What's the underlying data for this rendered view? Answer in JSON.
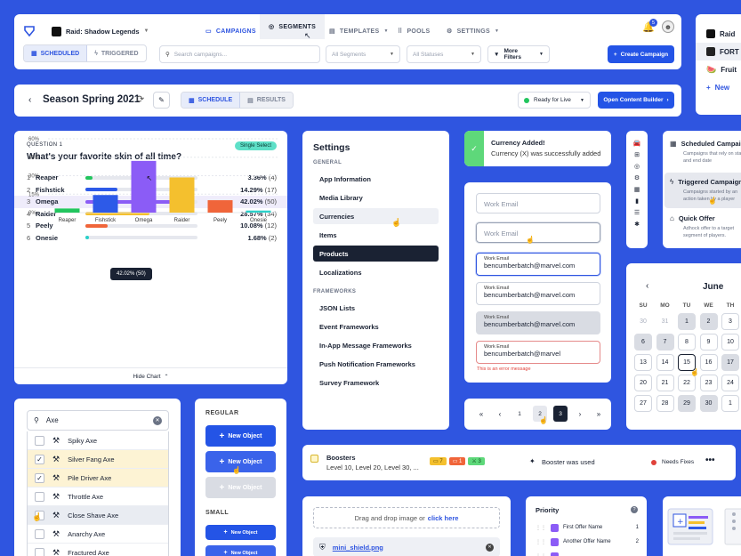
{
  "topnav": {
    "game": "Raid: Shadow Legends",
    "tabs": [
      {
        "label": "CAMPAIGNS",
        "icon": "megaphone-icon"
      },
      {
        "label": "SEGMENTS",
        "icon": "target-icon"
      },
      {
        "label": "TEMPLATES",
        "icon": "template-icon"
      },
      {
        "label": "POOLS",
        "icon": "grid-icon"
      },
      {
        "label": "SETTINGS",
        "icon": "gear-icon"
      }
    ],
    "notif_count": "5",
    "mode_scheduled": "SCHEDULED",
    "mode_triggered": "TRIGGERED",
    "search_placeholder": "Search campaigns...",
    "segments_select": "All Segments",
    "statuses_select": "All Statuses",
    "more_filters": "More Filters",
    "create_campaign": "Create Campaign"
  },
  "gamelist": {
    "items": [
      "Raid",
      "FORT",
      "Fruit"
    ],
    "new_label": "New"
  },
  "seasonbar": {
    "title": "Season Spring 2021",
    "tab_schedule": "SCHEDULE",
    "tab_results": "RESULTS",
    "status": "Ready for Live",
    "status_color": "#22c55e",
    "open_builder": "Open Content Builder"
  },
  "question": {
    "label": "QUESTION 1",
    "badge": "Single Select",
    "title": "What's your favorite skin of all time?",
    "options": [
      {
        "n": "1",
        "name": "Reaper",
        "pct": "3.36%",
        "count": "(4)",
        "value": 3.36,
        "color": "#22c55e"
      },
      {
        "n": "2",
        "name": "Fishstick",
        "pct": "14.29%",
        "count": "(17)",
        "value": 14.29,
        "color": "#2d5ae8"
      },
      {
        "n": "3",
        "name": "Omega",
        "pct": "42.02%",
        "count": "(50)",
        "value": 42.02,
        "color": "#8b5cf6"
      },
      {
        "n": "4",
        "name": "Raider",
        "pct": "28.57%",
        "count": "(34)",
        "value": 28.57,
        "color": "#f4c02e"
      },
      {
        "n": "5",
        "name": "Peely",
        "pct": "10.08%",
        "count": "(12)",
        "value": 10.08,
        "color": "#f0653a"
      },
      {
        "n": "6",
        "name": "Onesie",
        "pct": "1.68%",
        "count": "(2)",
        "value": 1.68,
        "color": "#2ad1c9"
      }
    ],
    "tooltip": "42.02% (50)",
    "hide_chart": "Hide Chart"
  },
  "chart_data": {
    "type": "bar",
    "categories": [
      "Reaper",
      "Fishstick",
      "Omega",
      "Raider",
      "Peely",
      "Onesie"
    ],
    "values": [
      3.36,
      14.29,
      42.02,
      28.57,
      10.08,
      1.68
    ],
    "yticks": [
      "60%",
      "45%",
      "30%",
      "15%",
      "0%"
    ],
    "ylim": [
      0,
      60
    ],
    "colors": [
      "#22c55e",
      "#2d5ae8",
      "#8b5cf6",
      "#f4c02e",
      "#f0653a",
      "#2ad1c9"
    ]
  },
  "settings": {
    "title": "Settings",
    "general": "GENERAL",
    "general_items": [
      "App Information",
      "Media Library",
      "Currencies",
      "Items",
      "Products",
      "Localizations"
    ],
    "frameworks": "FRAMEWORKS",
    "framework_items": [
      "JSON Lists",
      "Event Frameworks",
      "In-App Message Frameworks",
      "Push Notification Frameworks",
      "Survey Framework"
    ]
  },
  "toast": {
    "title": "Currency Added!",
    "message": "Currency (X) was successfully added"
  },
  "inputs": {
    "placeholder": "Work Email",
    "label": "Work Email",
    "value": "bencumberbatch@marvel.com",
    "value_error": "bencumberbatch@marvel",
    "error": "This is an error message"
  },
  "pager": {
    "first": "«",
    "prev": "‹",
    "pages": [
      "1",
      "2",
      "3"
    ],
    "next": "›",
    "last": "»"
  },
  "ctype": {
    "items": [
      {
        "title": "Scheduled Campaign",
        "desc": "Campaigns that rely on start and end date"
      },
      {
        "title": "Triggered Campaign",
        "desc": "Campaigns started by an action taken by a player"
      },
      {
        "title": "Quick Offer",
        "desc": "Adhock offer to a target segment of players."
      }
    ]
  },
  "calendar": {
    "month": "June",
    "days": [
      "SU",
      "MO",
      "TU",
      "WE",
      "TH"
    ],
    "rows": [
      [
        "30",
        "31",
        "1",
        "2",
        "3"
      ],
      [
        "6",
        "7",
        "8",
        "9",
        "10"
      ],
      [
        "13",
        "14",
        "15",
        "16",
        "17"
      ],
      [
        "20",
        "21",
        "22",
        "23",
        "24"
      ],
      [
        "27",
        "28",
        "29",
        "30",
        "1"
      ]
    ]
  },
  "searchlist": {
    "query": "Axe",
    "items": [
      {
        "name": "Spiky Axe",
        "checked": false
      },
      {
        "name": "Silver Fang Axe",
        "checked": true
      },
      {
        "name": "Pile Driver Axe",
        "checked": true
      },
      {
        "name": "Throttle Axe",
        "checked": false
      },
      {
        "name": "Close Shave Axe",
        "checked": false
      },
      {
        "name": "Anarchy Axe",
        "checked": false
      },
      {
        "name": "Fractured Axe",
        "checked": false
      }
    ]
  },
  "buttons": {
    "regular": "REGULAR",
    "small": "SMALL",
    "label": "New Object"
  },
  "boosters": {
    "title": "Boosters",
    "sub": "Level 10, Level 20, Level 30, ...",
    "tags": [
      "7",
      "1",
      "3"
    ],
    "event": "Booster was used",
    "status": "Needs Fixes"
  },
  "upload": {
    "drop": "Drag and drop image or",
    "click": "click here",
    "file": "mini_shield.png"
  },
  "priority": {
    "title": "Priority",
    "items": [
      {
        "name": "First Offer Name",
        "n": "1"
      },
      {
        "name": "Another Offer Name",
        "n": "2"
      }
    ]
  }
}
